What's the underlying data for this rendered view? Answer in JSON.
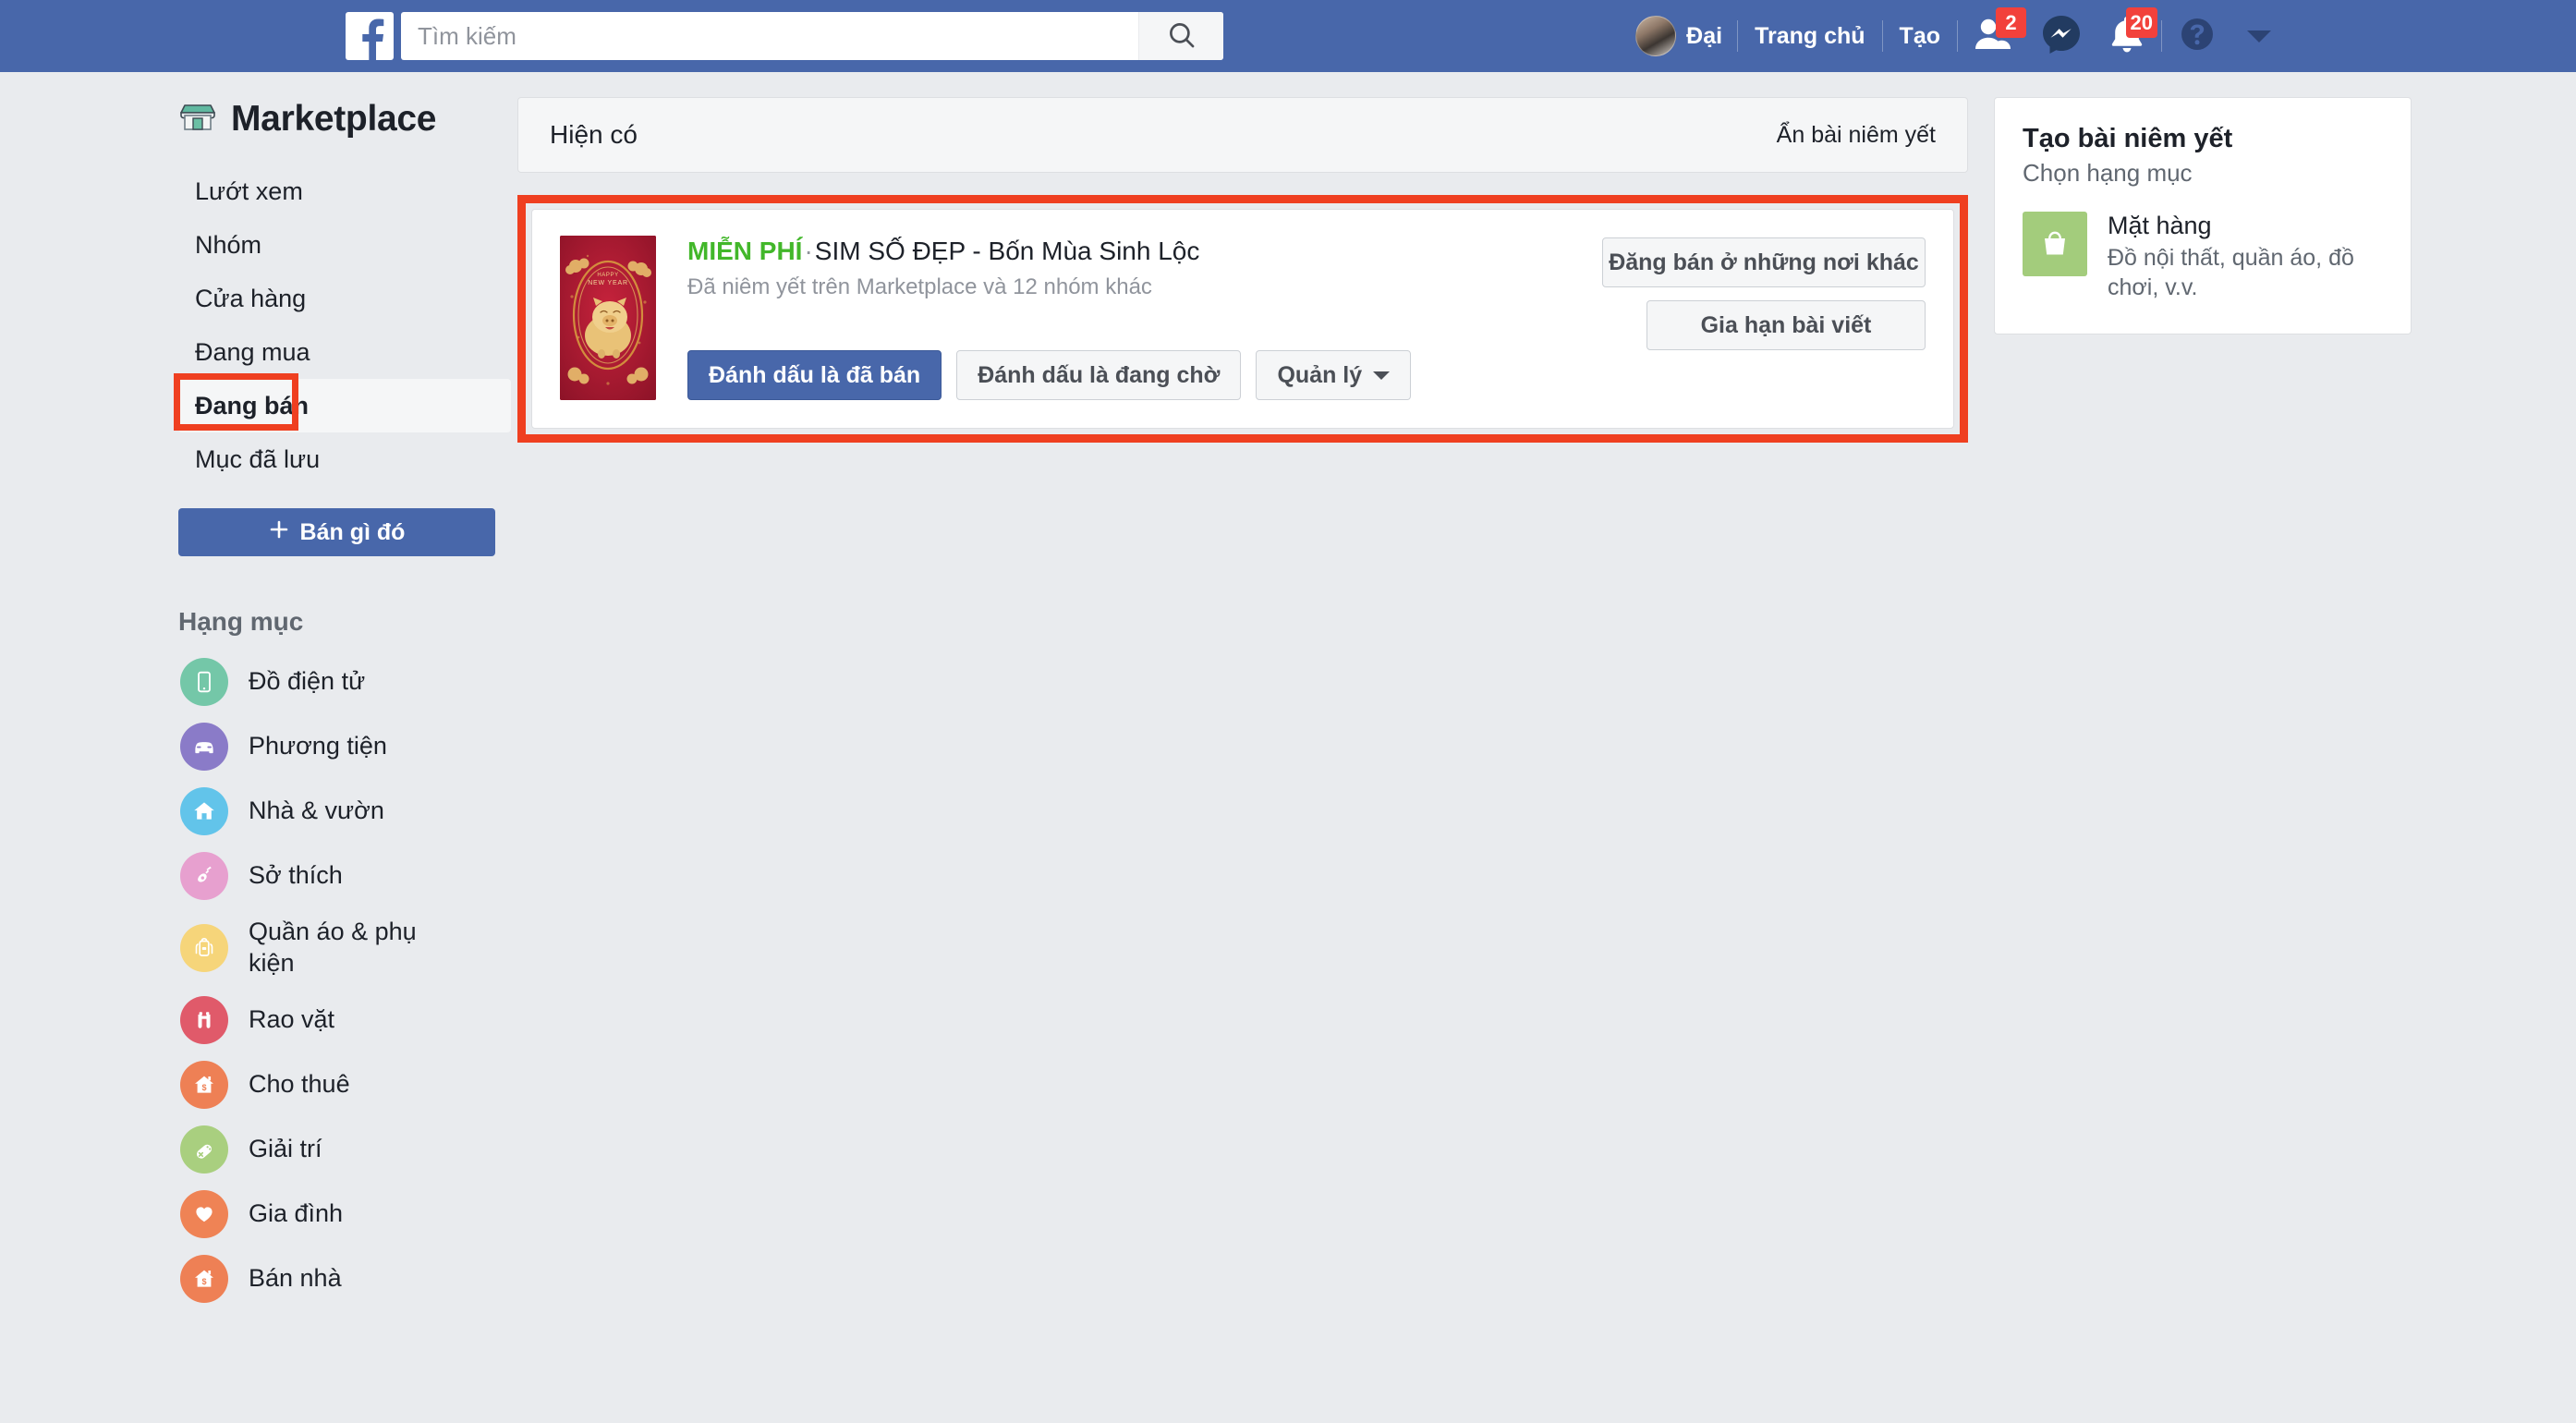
{
  "topbar": {
    "logo_icon": "facebook-f-logo",
    "search": {
      "placeholder": "Tìm kiếm",
      "value": "",
      "button_icon": "search-icon"
    },
    "profile_name": "Đại",
    "avatar_icon": "user-avatar",
    "links": [
      {
        "label": "Trang chủ",
        "name": "home-link"
      },
      {
        "label": "Tạo",
        "name": "create-link"
      }
    ],
    "icons": [
      {
        "name": "friend-requests-icon",
        "badge": "2"
      },
      {
        "name": "messenger-icon",
        "badge": ""
      },
      {
        "name": "notifications-bell-icon",
        "badge": "20"
      },
      {
        "name": "help-question-icon",
        "badge": ""
      }
    ],
    "account_menu_icon": "chevron-down-icon"
  },
  "sidebar": {
    "brand": {
      "label": "Marketplace",
      "icon": "storefront-icon"
    },
    "nav_items": [
      {
        "label": "Lướt xem",
        "name": "sidebar-item-browse",
        "active": false
      },
      {
        "label": "Nhóm",
        "name": "sidebar-item-groups",
        "active": false
      },
      {
        "label": "Cửa hàng",
        "name": "sidebar-item-shops",
        "active": false
      },
      {
        "label": "Đang mua",
        "name": "sidebar-item-buying",
        "active": false
      },
      {
        "label": "Đang bán",
        "name": "sidebar-item-selling",
        "active": true
      },
      {
        "label": "Mục đã lưu",
        "name": "sidebar-item-saved",
        "active": false
      }
    ],
    "sell_button": {
      "label": "Bán gì đó",
      "icon": "plus-icon"
    },
    "categories_header": "Hạng mục",
    "categories": [
      {
        "label": "Đồ điện tử",
        "icon": "phone-icon",
        "color": "#74c7a8"
      },
      {
        "label": "Phương tiện",
        "icon": "car-icon",
        "color": "#8a7bc8"
      },
      {
        "label": "Nhà & vườn",
        "icon": "house-icon",
        "color": "#62c4ea"
      },
      {
        "label": "Sở thích",
        "icon": "guitar-icon",
        "color": "#e7a0cf"
      },
      {
        "label": "Quần áo & phụ kiện",
        "icon": "backpack-icon",
        "color": "#f6d57a"
      },
      {
        "label": "Rao vặt",
        "icon": "binoculars-icon",
        "color": "#e05a6a"
      },
      {
        "label": "Cho thuê",
        "icon": "house-rent-icon",
        "color": "#ee8055"
      },
      {
        "label": "Giải trí",
        "icon": "gamepad-icon",
        "color": "#a9cf7f"
      },
      {
        "label": "Gia đình",
        "icon": "heart-icon",
        "color": "#ef8355"
      },
      {
        "label": "Bán nhà",
        "icon": "house-sale-icon",
        "color": "#ee8055"
      }
    ]
  },
  "main": {
    "section_title": "Hiện có",
    "hide_listing_link": "Ẩn bài niêm yết",
    "listing": {
      "thumbnail_icon": "lunar-new-year-pig-image",
      "price_label": "MIỄN PHÍ",
      "separator": "·",
      "title": "SIM SỐ ĐẸP - Bốn Mùa Sinh Lộc",
      "subtitle": "Đã niêm yết trên Marketplace và 12 nhóm khác",
      "actions": [
        {
          "label": "Đánh dấu là đã bán",
          "name": "mark-as-sold-button",
          "style": "primary"
        },
        {
          "label": "Đánh dấu là đang chờ",
          "name": "mark-as-pending-button",
          "style": "secondary"
        },
        {
          "label": "Quản lý",
          "name": "manage-button",
          "style": "secondary",
          "caret": true
        }
      ],
      "side_actions": [
        {
          "label": "Đăng bán ở những nơi khác",
          "name": "sell-elsewhere-button"
        },
        {
          "label": "Gia hạn bài viết",
          "name": "renew-post-button"
        }
      ]
    }
  },
  "right_panel": {
    "title": "Tạo bài niêm yết",
    "subtitle": "Chọn hạng mục",
    "option": {
      "icon": "shopping-bag-icon",
      "title": "Mặt hàng",
      "description": "Đồ nội thất, quần áo, đồ chơi, v.v."
    }
  },
  "annotations": {
    "highlight_color": "#ef3f20",
    "boxes": [
      "sidebar-item-selling",
      "listing-card"
    ]
  },
  "colors": {
    "brand_blue": "#4867aa",
    "page_bg": "#e9ebee",
    "panel_bg": "#f5f6f7",
    "free_green": "#42b72a",
    "badge_red": "#f2413b"
  }
}
